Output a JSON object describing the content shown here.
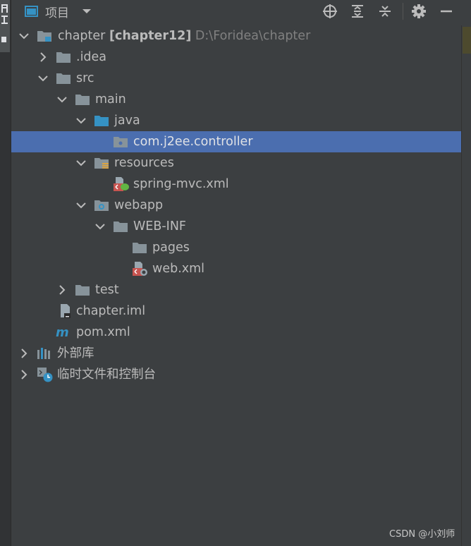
{
  "toolbar": {
    "title": "项目",
    "icons": [
      "project-window-icon",
      "dropdown-caret-icon",
      "locate-target-icon",
      "expand-all-icon",
      "collapse-all-icon",
      "settings-gear-icon",
      "hide-minimize-icon"
    ]
  },
  "tree": {
    "root": {
      "name": "chapter",
      "module": "[chapter12]",
      "path": "D:\\Foridea\\chapter"
    },
    "idea": ".idea",
    "src": "src",
    "main": "main",
    "java": "java",
    "package": "com.j2ee.controller",
    "resources": "resources",
    "spring_mvc": "spring-mvc.xml",
    "webapp": "webapp",
    "web_inf": "WEB-INF",
    "pages": "pages",
    "web_xml": "web.xml",
    "test": "test",
    "chapter_iml": "chapter.iml",
    "pom": "pom.xml",
    "external_libs": "外部库",
    "scratches": "临时文件和控制台"
  },
  "watermark": "CSDN @小刘师",
  "colors": {
    "background": "#3c3f41",
    "selection": "#4b6eaf",
    "folder": "#87939a",
    "source_folder": "#3592c4",
    "text": "#bbbbbb"
  }
}
